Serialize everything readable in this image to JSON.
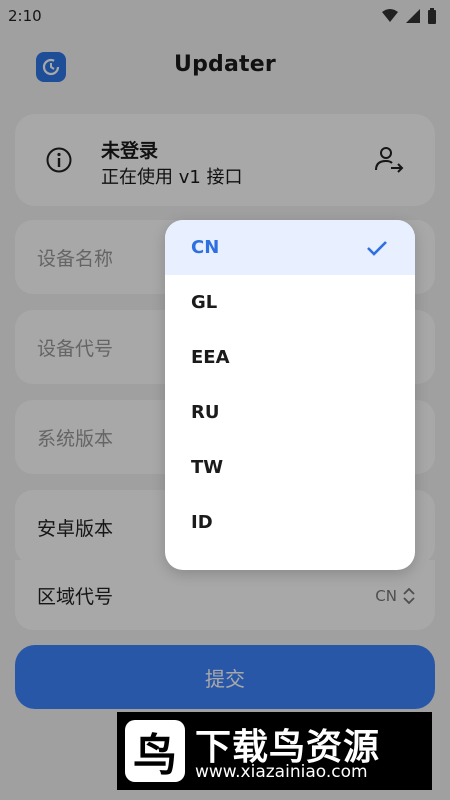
{
  "status": {
    "time": "2:10",
    "icons": [
      "wifi-icon",
      "signal-icon",
      "battery-icon"
    ]
  },
  "header": {
    "title": "Updater",
    "logo_icon": "update-icon"
  },
  "login": {
    "title": "未登录",
    "subtitle": "正在使用 v1 接口",
    "info_icon": "info-icon",
    "action_icon": "login-user-icon"
  },
  "fields": {
    "device_name": "设备名称",
    "device_code": "设备代号",
    "system_version": "系统版本",
    "android_version": "安卓版本",
    "region_code": "区域代号",
    "region_value": "CN"
  },
  "submit": {
    "label": "提交"
  },
  "dropdown": {
    "options": [
      "CN",
      "GL",
      "EEA",
      "RU",
      "TW",
      "ID"
    ],
    "selected": "CN"
  },
  "watermark": {
    "logo_text": "鸟",
    "title": "下载鸟资源",
    "url": "www.xiazainiao.com"
  },
  "colors": {
    "accent": "#2f77e8",
    "button": "#3e84ff",
    "selected_bg": "#e8f0ff"
  }
}
